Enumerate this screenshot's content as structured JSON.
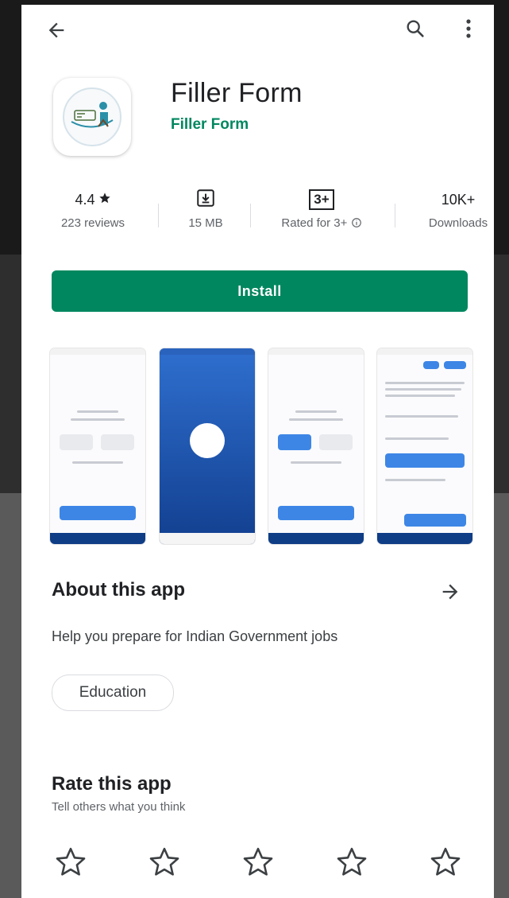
{
  "app": {
    "title": "Filler Form",
    "developer": "Filler Form",
    "icon": "app-logo-icon"
  },
  "stats": {
    "rating_value": "4.4",
    "rating_label": "223 reviews",
    "size_icon": "download-icon",
    "size_label": "15 MB",
    "content_rating_badge": "3+",
    "content_rating_label": "Rated for 3+",
    "downloads_value": "10K+",
    "downloads_label": "Downloads"
  },
  "actions": {
    "install_label": "Install"
  },
  "about": {
    "title": "About this app",
    "description": "Help you prepare for Indian Government jobs",
    "category_chip": "Education"
  },
  "rate": {
    "title": "Rate this app",
    "subtitle": "Tell others what you think",
    "stars": 5
  },
  "colors": {
    "accent": "#01875f",
    "title_text": "#202124",
    "secondary_text": "#5f6368"
  }
}
